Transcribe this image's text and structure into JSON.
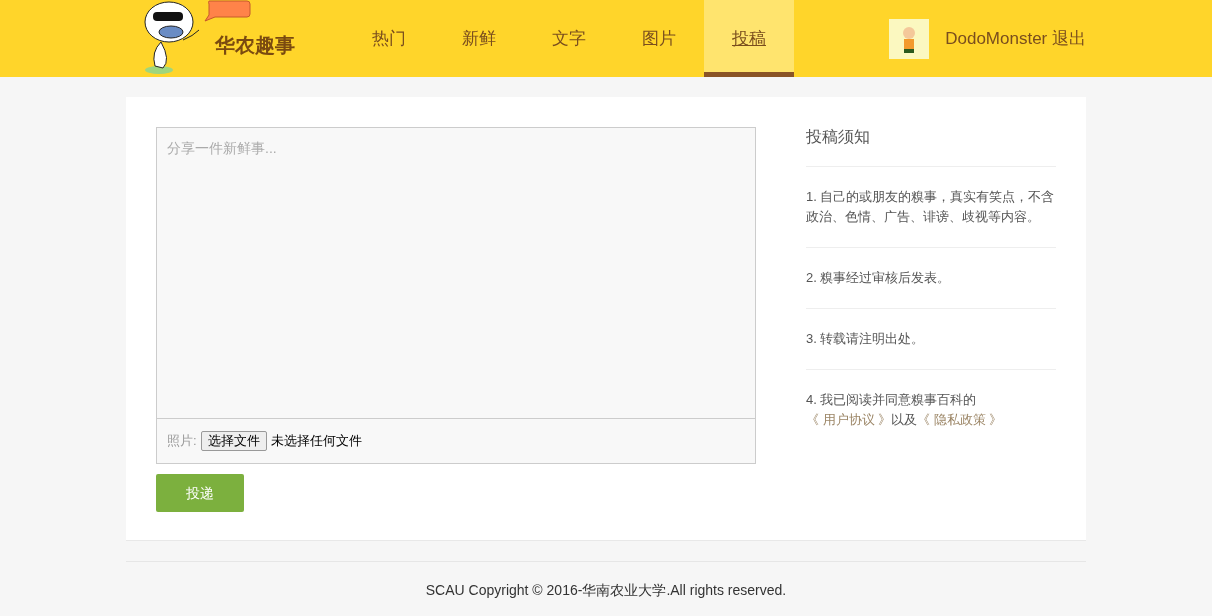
{
  "header": {
    "logo_text": "华农趣事",
    "nav": [
      {
        "label": "热门",
        "selected": false
      },
      {
        "label": "新鲜",
        "selected": false
      },
      {
        "label": "文字",
        "selected": false
      },
      {
        "label": "图片",
        "selected": false
      },
      {
        "label": "投稿",
        "selected": true
      }
    ],
    "user": {
      "name": "DodoMonster",
      "logout": "退出"
    }
  },
  "form": {
    "placeholder": "分享一件新鲜事...",
    "photo_label": "照片:",
    "file_button": "选择文件",
    "file_status": "未选择任何文件",
    "submit": "投递"
  },
  "notice": {
    "title": "投稿须知",
    "items": [
      {
        "parts": [
          {
            "kind": "text",
            "text": "1. 自己的或朋友的糗事，真实有笑点，不含政治、色情、广告、诽谤、歧视等内容。"
          }
        ]
      },
      {
        "parts": [
          {
            "kind": "text",
            "text": "2. 糗事经过审核后发表。"
          }
        ]
      },
      {
        "parts": [
          {
            "kind": "text",
            "text": "3. 转载请注明出处。"
          }
        ]
      },
      {
        "parts": [
          {
            "kind": "text",
            "text": "4. 我已阅读并同意糗事百科的"
          },
          {
            "kind": "link",
            "text": "《 用户协议 》"
          },
          {
            "kind": "text",
            "text": "以及"
          },
          {
            "kind": "link",
            "text": "《 隐私政策 》"
          }
        ]
      }
    ]
  },
  "footer": "SCAU Copyright © 2016-华南农业大学.All rights reserved."
}
